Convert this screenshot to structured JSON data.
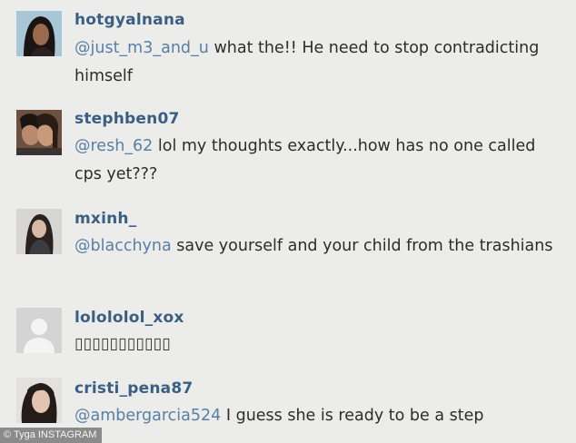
{
  "comments": [
    {
      "username": "hotgyalnana",
      "mention": "@just_m3_and_u",
      "text": " what the!! He need to stop contradicting himself"
    },
    {
      "username": "stephben07",
      "mention": "@resh_62",
      "text": " lol my thoughts exactly...how has no one called cps yet???"
    },
    {
      "username": "mxinh_",
      "mention": "@blacchyna",
      "text": " save yourself and your child from the trashians"
    },
    {
      "username": "lolololol_xox",
      "mention": "",
      "text": "▯▯▯▯▯▯▯▯▯▯▯"
    },
    {
      "username": "cristi_pena87",
      "mention": "@ambergarcia524",
      "text": " I guess she is ready to be a step"
    }
  ],
  "credit": "© Tyga INSTAGRAM",
  "colors": {
    "username": "#3b5f82",
    "mention": "#5b7ea3",
    "text": "#2c2c2c",
    "background": "#ececeb"
  }
}
